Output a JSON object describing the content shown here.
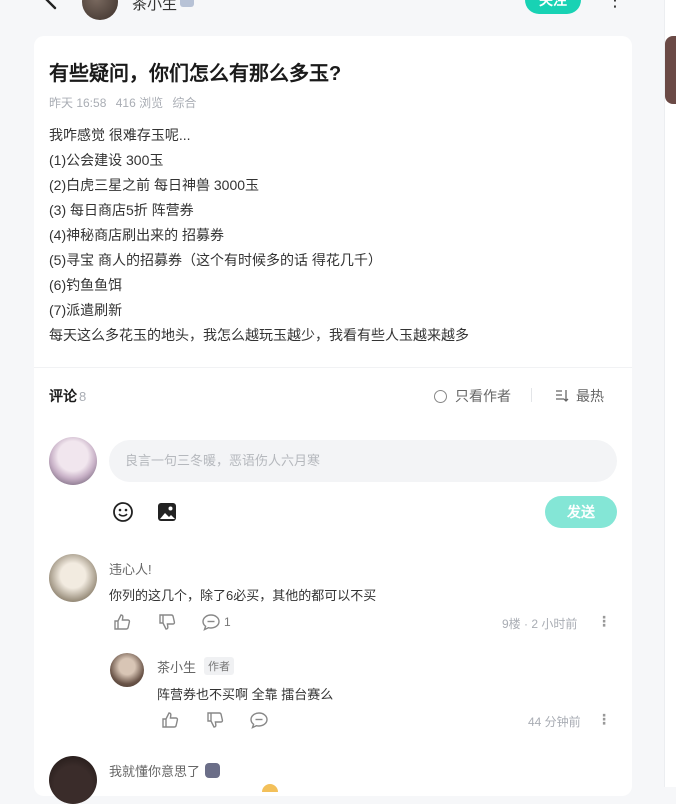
{
  "header": {
    "author_name": "茶小生",
    "follow_label": "关注",
    "more_label": "⋮"
  },
  "post": {
    "title": "有些疑问，你们怎么有那么多玉?",
    "time": "昨天 16:58",
    "views": "416 浏览",
    "category": "综合",
    "lines": [
      "我咋感觉 很难存玉呢...",
      "(1)公会建设 300玉",
      "(2)白虎三星之前 每日神兽 3000玉",
      "(3)  每日商店5折 阵营券",
      "(4)神秘商店刷出来的 招募券",
      "(5)寻宝 商人的招募券（这个有时候多的话 得花几千）",
      "(6)钓鱼鱼饵",
      "(7)派遣刷新",
      "每天这么多花玉的地头，我怎么越玩玉越少，我看有些人玉越来越多"
    ]
  },
  "comments_bar": {
    "label": "评论",
    "count": "8",
    "author_only": "只看作者",
    "sort": "最热"
  },
  "composer": {
    "placeholder": "良言一句三冬暖，恶语伤人六月寒",
    "send_label": "发送"
  },
  "comments": [
    {
      "name": "违心人!",
      "text": "你列的这几个，除了6必买，其他的都可以不买",
      "reply_count": "1",
      "floor_time": "9楼 · 2 小时前",
      "replies": [
        {
          "name": "茶小生",
          "tag": "作者",
          "text": "阵营券也不买啊  全靠 擂台赛么",
          "time": "44 分钟前"
        }
      ]
    },
    {
      "name": "我就懂你意思了"
    }
  ],
  "colors": {
    "accent": "#18d2b4",
    "send_disabled": "#84e6d6",
    "background": "#f6f7f9"
  }
}
